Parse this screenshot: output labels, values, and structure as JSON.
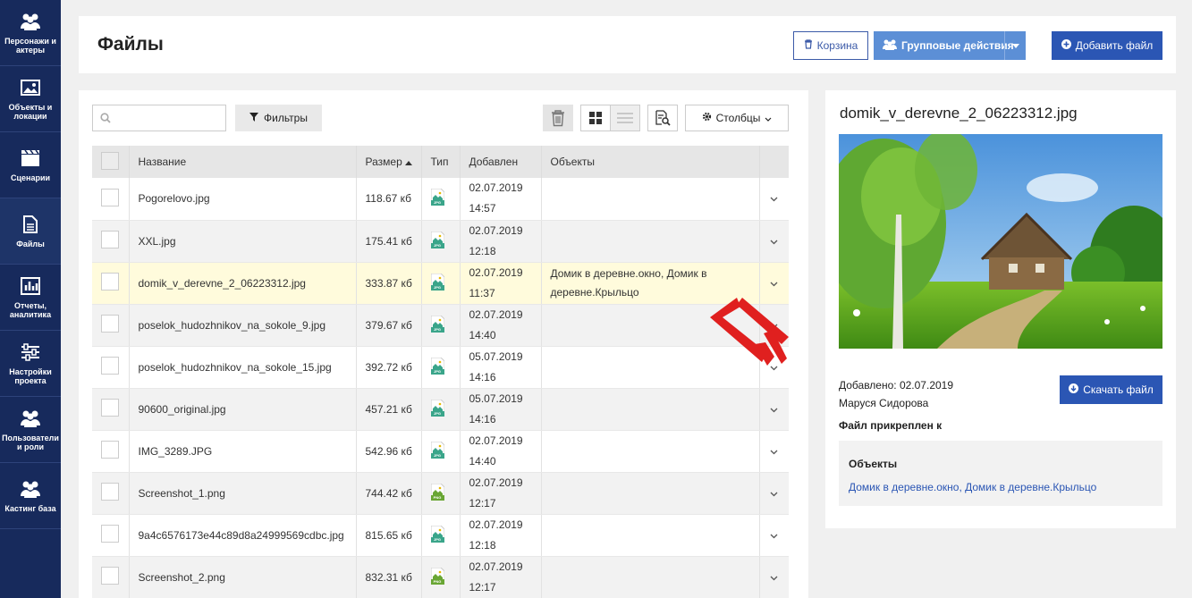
{
  "sidebar": {
    "items": [
      {
        "label": "Персонажи и актеры",
        "icon": "people-icon"
      },
      {
        "label": "Объекты и локации",
        "icon": "image-icon"
      },
      {
        "label": "Сценарии",
        "icon": "clapperboard-icon"
      },
      {
        "label": "Файлы",
        "icon": "document-icon"
      },
      {
        "label": "Отчеты, аналитика",
        "icon": "chart-icon"
      },
      {
        "label": "Настройки проекта",
        "icon": "sliders-icon"
      },
      {
        "label": "Пользователи и роли",
        "icon": "users-icon"
      },
      {
        "label": "Кастинг база",
        "icon": "casting-icon"
      }
    ]
  },
  "header": {
    "title": "Файлы",
    "basket_label": "Корзина",
    "group_actions_label": "Групповые действия",
    "add_file_label": "Добавить файл"
  },
  "toolbar": {
    "search_placeholder": "",
    "filters_label": "Фильтры",
    "columns_label": "Столбцы"
  },
  "table": {
    "columns": [
      "Название",
      "Размер",
      "Тип",
      "Добавлен",
      "Объекты"
    ],
    "sort_column": "Размер",
    "rows": [
      {
        "name": "Pogorelovo.jpg",
        "size": "118.67 кб",
        "type": "JPG",
        "date": "02.07.2019",
        "time": "14:57",
        "objects": ""
      },
      {
        "name": "XXL.jpg",
        "size": "175.41 кб",
        "type": "JPG",
        "date": "02.07.2019",
        "time": "12:18",
        "objects": ""
      },
      {
        "name": "domik_v_derevne_2_06223312.jpg",
        "size": "333.87 кб",
        "type": "JPG",
        "date": "02.07.2019",
        "time": "11:37",
        "objects": "Домик в деревне.окно, Домик в деревне.Крыльцо"
      },
      {
        "name": "poselok_hudozhnikov_na_sokole_9.jpg",
        "size": "379.67 кб",
        "type": "JPG",
        "date": "02.07.2019",
        "time": "14:40",
        "objects": ""
      },
      {
        "name": "poselok_hudozhnikov_na_sokole_15.jpg",
        "size": "392.72 кб",
        "type": "JPG",
        "date": "05.07.2019",
        "time": "14:16",
        "objects": ""
      },
      {
        "name": "90600_original.jpg",
        "size": "457.21 кб",
        "type": "JPG",
        "date": "05.07.2019",
        "time": "14:16",
        "objects": ""
      },
      {
        "name": "IMG_3289.JPG",
        "size": "542.96 кб",
        "type": "JPG",
        "date": "02.07.2019",
        "time": "14:40",
        "objects": ""
      },
      {
        "name": "Screenshot_1.png",
        "size": "744.42 кб",
        "type": "PNG",
        "date": "02.07.2019",
        "time": "12:17",
        "objects": ""
      },
      {
        "name": "9a4c6576173e44c89d8a24999569cdbc.jpg",
        "size": "815.65 кб",
        "type": "JPG",
        "date": "02.07.2019",
        "time": "12:18",
        "objects": ""
      },
      {
        "name": "Screenshot_2.png",
        "size": "832.31 кб",
        "type": "PNG",
        "date": "02.07.2019",
        "time": "12:17",
        "objects": ""
      }
    ]
  },
  "details": {
    "title": "domik_v_derevne_2_06223312.jpg",
    "added": "Добавлено: 02.07.2019",
    "author": "Маруся Сидорова",
    "download_label": "Скачать файл",
    "attached_label": "Файл прикреплен к",
    "objects_title": "Объекты",
    "objects_link": "Домик в деревне.окно, Домик в деревне.Крыльцо"
  },
  "colors": {
    "sidebar": "#172a5c",
    "primary": "#2b56b4",
    "group_button": "#5c8fd6",
    "selected_row": "#fffbdc",
    "annotation_arrow": "#e0201f"
  }
}
